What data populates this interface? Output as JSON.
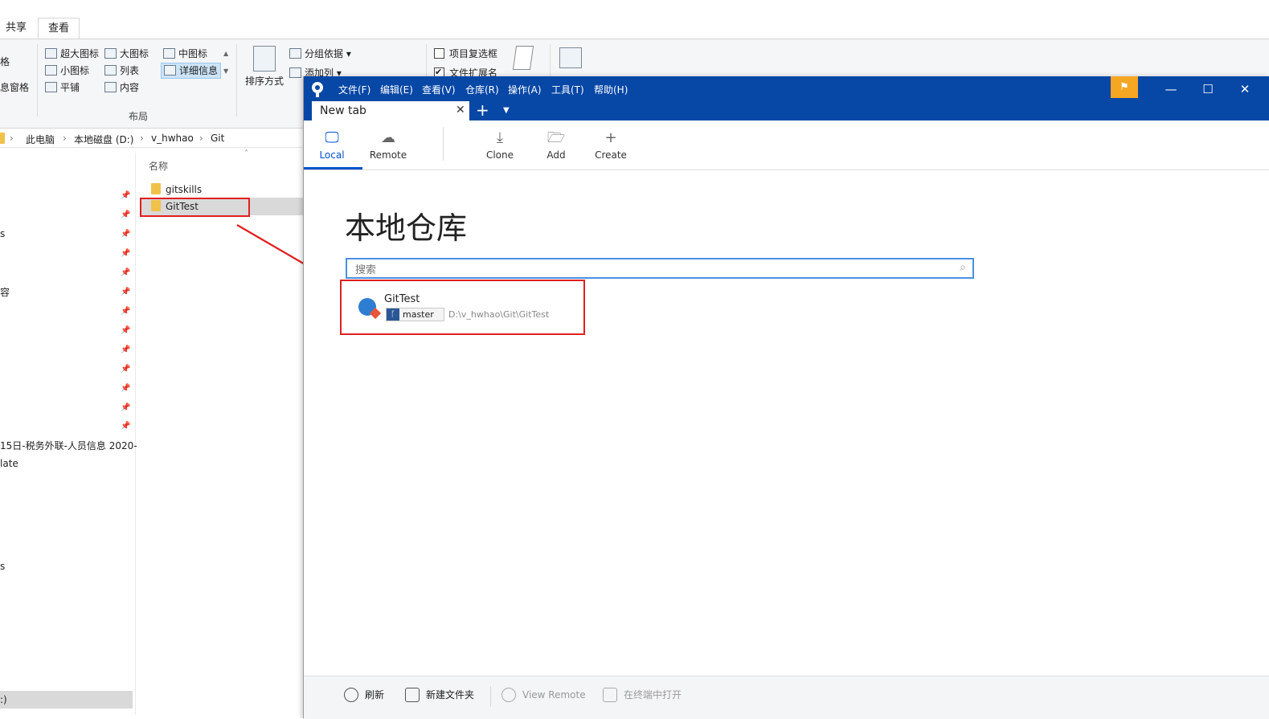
{
  "explorer": {
    "ribbon_tabs": [
      "共享",
      "查看"
    ],
    "left_labels": [
      "格",
      "息窗格"
    ],
    "layout_items": [
      "超大图标",
      "大图标",
      "中图标",
      "小图标",
      "列表",
      "详细信息",
      "平铺",
      "内容"
    ],
    "layout_group_label": "布局",
    "sort_label": "排序方式",
    "group_by": "分组依据",
    "add_column": "添加列",
    "item_checkboxes": "项目复选框",
    "file_extensions": "文件扩展名",
    "breadcrumb": [
      "此电脑",
      "本地磁盘 (D:)",
      "v_hwhao",
      "Git"
    ],
    "column_name": "名称",
    "files": [
      "gitskills",
      "GitTest"
    ],
    "nav_fragments": [
      "s",
      "容",
      "15日-税务外联-人员信息 2020-",
      "late",
      "s",
      ":)"
    ]
  },
  "sourcetree": {
    "menu": [
      "文件(F)",
      "编辑(E)",
      "查看(V)",
      "仓库(R)",
      "操作(A)",
      "工具(T)",
      "帮助(H)"
    ],
    "tab_title": "New tab",
    "toolbar": {
      "local": "Local",
      "remote": "Remote",
      "clone": "Clone",
      "add": "Add",
      "create": "Create"
    },
    "page_title": "本地仓库",
    "search_placeholder": "搜索",
    "repo": {
      "name": "GitTest",
      "branch": "master",
      "path": "D:\\v_hwhao\\Git\\GitTest"
    },
    "bottom": {
      "refresh": "刷新",
      "new_folder": "新建文件夹",
      "view_remote": "View Remote",
      "open_terminal": "在终端中打开"
    },
    "colors": {
      "titlebar": "#0747a6",
      "accent": "#0052cc",
      "flag": "#f5a623",
      "annotation": "#e02020"
    }
  }
}
